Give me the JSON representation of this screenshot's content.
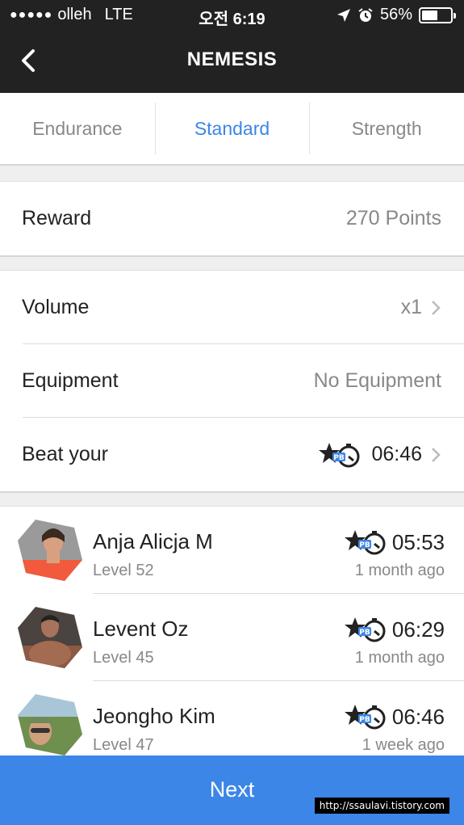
{
  "status_bar": {
    "signal_dots": "●●●●●",
    "carrier": "olleh",
    "network": "LTE",
    "time": "오전 6:19",
    "battery_percent": "56%",
    "battery_level": 0.56,
    "icons": [
      "location-arrow-icon",
      "alarm-icon"
    ]
  },
  "nav": {
    "title": "NEMESIS",
    "back_icon": "chevron-left-icon"
  },
  "tabs": [
    {
      "label": "Endurance",
      "active": false
    },
    {
      "label": "Standard",
      "active": true
    },
    {
      "label": "Strength",
      "active": false
    }
  ],
  "reward": {
    "label": "Reward",
    "value": "270 Points"
  },
  "settings": {
    "volume": {
      "label": "Volume",
      "value": "x1"
    },
    "equipment": {
      "label": "Equipment",
      "value": "No Equipment"
    },
    "beat": {
      "label": "Beat your",
      "value": "06:46"
    }
  },
  "leaderboard": [
    {
      "name": "Anja Alicja M",
      "level": "Level 52",
      "time": "05:53",
      "ago": "1 month ago"
    },
    {
      "name": "Levent Oz",
      "level": "Level 45",
      "time": "06:29",
      "ago": "1 month ago"
    },
    {
      "name": "Jeongho Kim",
      "level": "Level 47",
      "time": "06:46",
      "ago": "1 week ago"
    }
  ],
  "next_button": {
    "label": "Next"
  },
  "watermark": "http://ssaulavi.tistory.com",
  "colors": {
    "accent": "#3b86e6",
    "header_bg": "#222222",
    "pb_badge": "#3b86e6"
  }
}
